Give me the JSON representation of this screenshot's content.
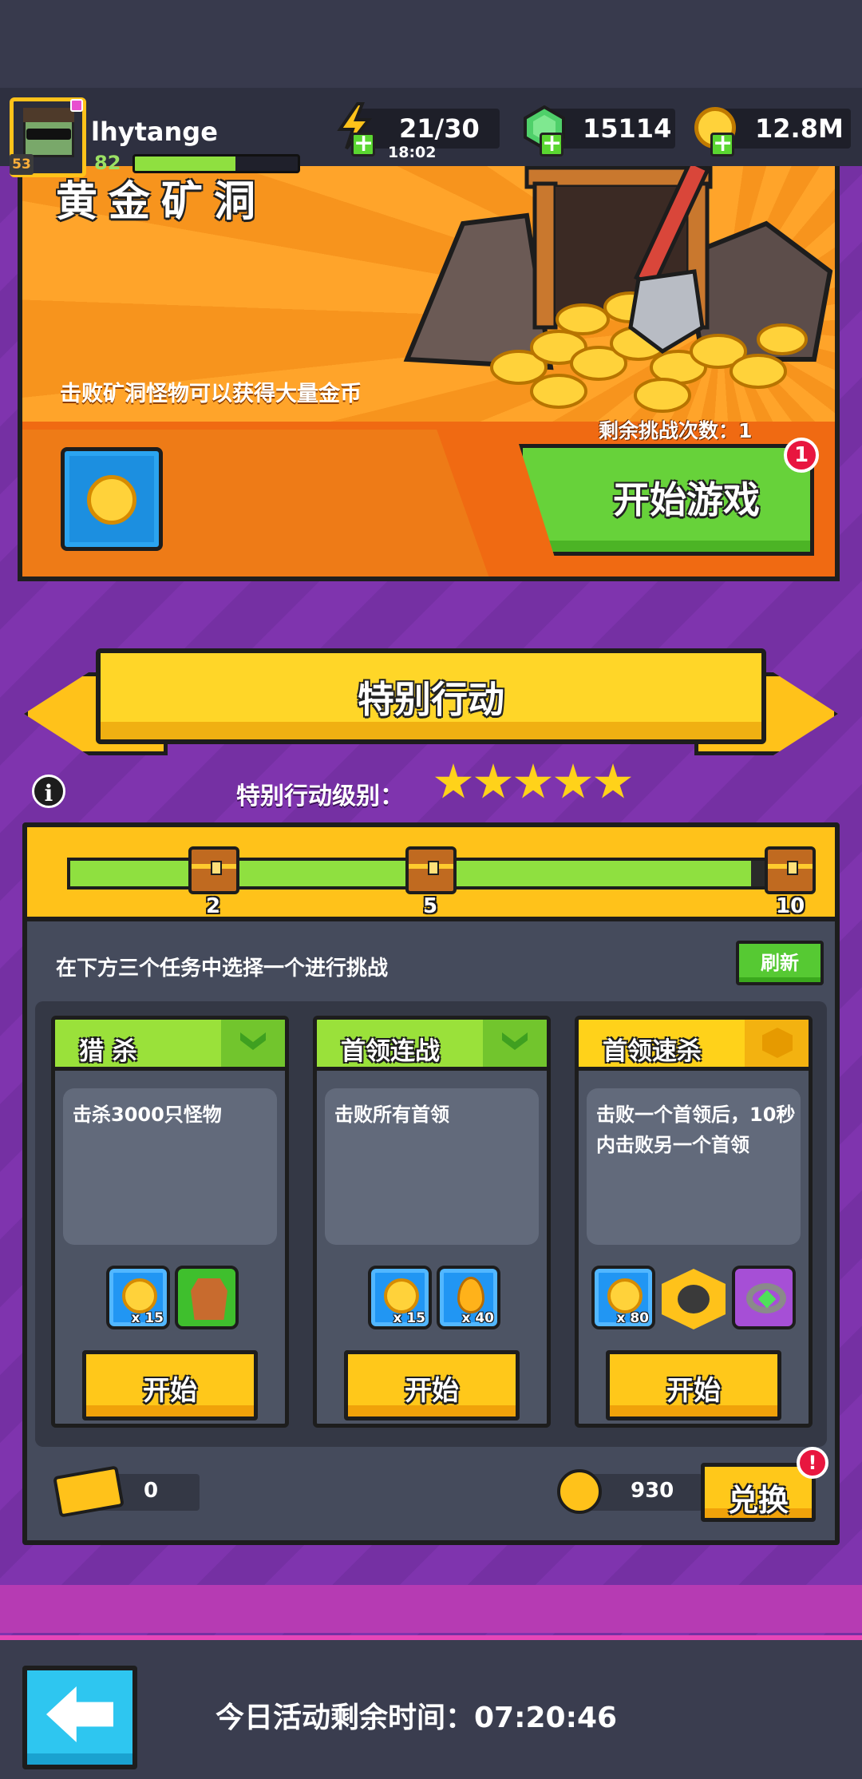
{
  "hud": {
    "username": "lhytange",
    "avatar_level": "53",
    "player_level": "82",
    "xp_fraction": 0.62,
    "energy": "21/30",
    "energy_timer": "18:02",
    "gems": "15114",
    "gold": "12.8M"
  },
  "gold_mine": {
    "title": "黄金矿洞",
    "description": "击败矿洞怪物可以获得大量金币",
    "remaining_label": "剩余挑战次数：1",
    "start_button": "开始游戏",
    "notification_count": "1"
  },
  "special_action": {
    "banner_title": "特别行动",
    "level_label": "特别行动级别：",
    "stars": 5,
    "progress_fraction": 0.93,
    "chest_milestones": [
      "2",
      "5",
      "10"
    ],
    "choose_text": "在下方三个任务中选择一个进行挑战",
    "refresh_button": "刷新",
    "tasks": [
      {
        "name": "猎 杀",
        "description": "击杀3000只怪物",
        "start_label": "开始",
        "rewards": [
          {
            "icon": "gold-token-icon",
            "qty": "x 15"
          },
          {
            "icon": "armor-icon",
            "qty": ""
          }
        ]
      },
      {
        "name": "首领连战",
        "description": "击败所有首领",
        "start_label": "开始",
        "rewards": [
          {
            "icon": "gold-token-icon",
            "qty": "x 15"
          },
          {
            "icon": "fire-essence-icon",
            "qty": "x 40"
          }
        ]
      },
      {
        "name": "首领速杀",
        "description": "击败一个首领后，10秒内击败另一个首领",
        "start_label": "开始",
        "rewards": [
          {
            "icon": "gold-token-icon",
            "qty": "x 80"
          },
          {
            "icon": "hex-gear-icon",
            "qty": ""
          },
          {
            "icon": "ring-icon",
            "qty": ""
          }
        ]
      }
    ],
    "ticket_count": "0",
    "token_count": "930",
    "exchange_button": "兑换",
    "exchange_notification": "!"
  },
  "footer": {
    "time_left": "今日活动剩余时间：07:20:46"
  },
  "colors": {
    "accent_yellow": "#ffc21a",
    "accent_green": "#67d23a",
    "background_purple": "#7a2fa8"
  }
}
